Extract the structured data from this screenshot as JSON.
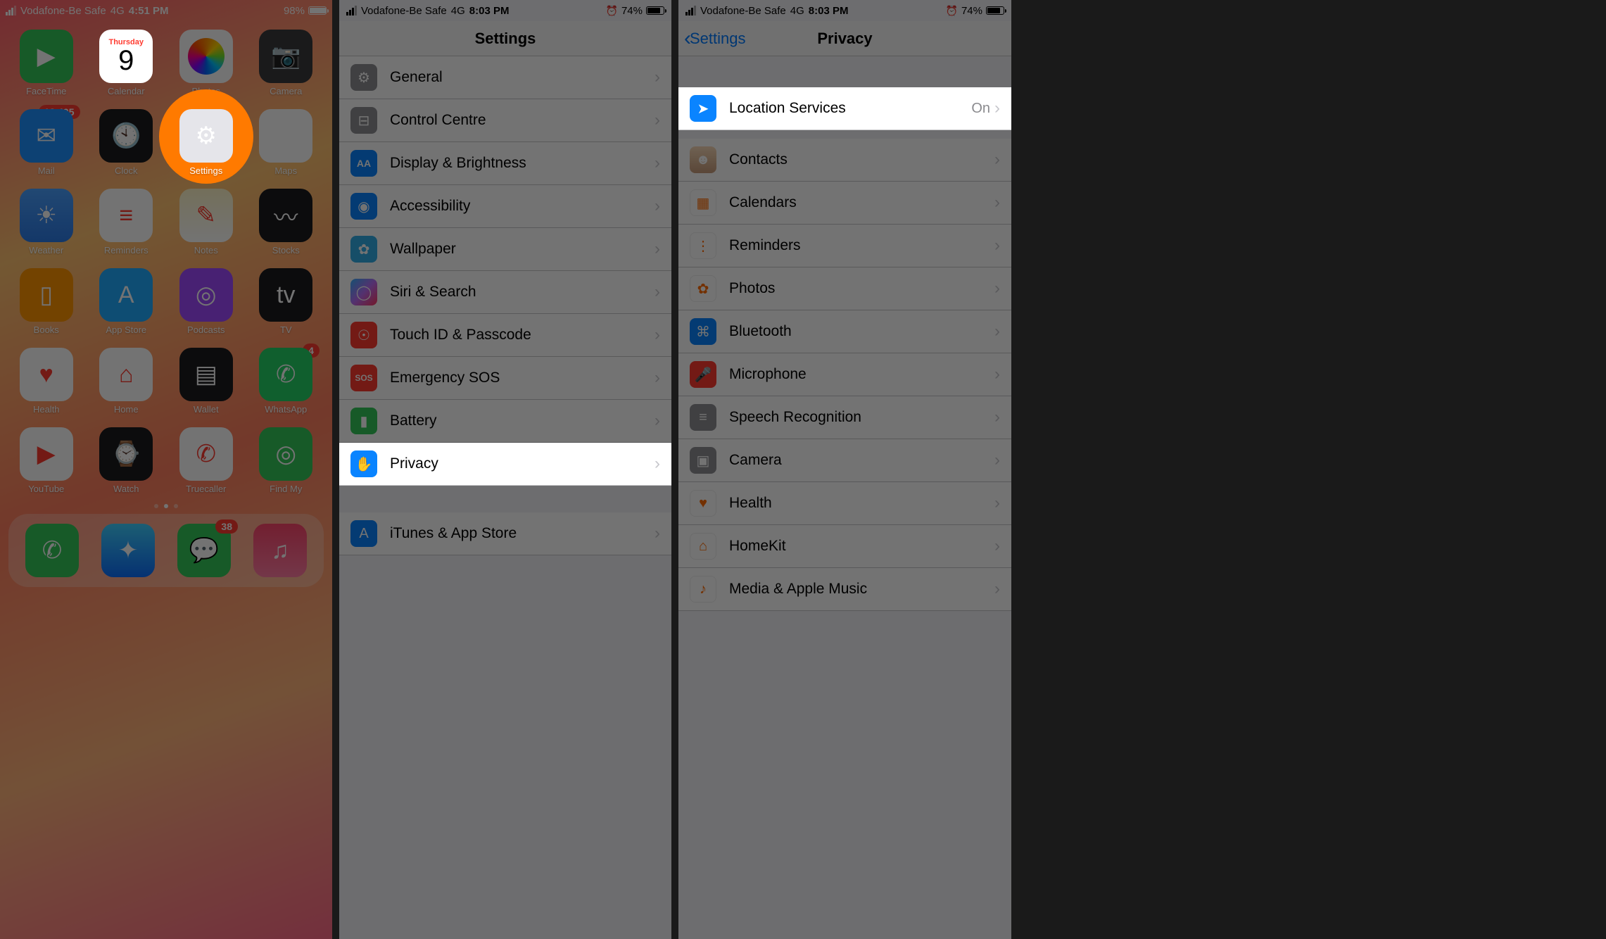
{
  "screen1": {
    "status": {
      "carrier": "Vodafone-Be Safe",
      "network": "4G",
      "time": "4:51 PM",
      "battery_pct": "98%"
    },
    "calendar": {
      "dow": "Thursday",
      "day": "9"
    },
    "apps": [
      {
        "name": "FaceTime",
        "icon": "facetime-icon"
      },
      {
        "name": "Calendar",
        "icon": "calendar-icon"
      },
      {
        "name": "Photos",
        "icon": "photos-icon"
      },
      {
        "name": "Camera",
        "icon": "camera-icon"
      },
      {
        "name": "Mail",
        "icon": "mail-icon",
        "badge": "18,495"
      },
      {
        "name": "Clock",
        "icon": "clock-icon"
      },
      {
        "name": "Settings",
        "icon": "settings-icon",
        "highlight": true
      },
      {
        "name": "Maps",
        "icon": "maps-icon"
      },
      {
        "name": "Weather",
        "icon": "weather-icon"
      },
      {
        "name": "Reminders",
        "icon": "reminders-icon"
      },
      {
        "name": "Notes",
        "icon": "notes-icon"
      },
      {
        "name": "Stocks",
        "icon": "stocks-icon"
      },
      {
        "name": "Books",
        "icon": "books-icon"
      },
      {
        "name": "App Store",
        "icon": "appstore-icon"
      },
      {
        "name": "Podcasts",
        "icon": "podcasts-icon"
      },
      {
        "name": "TV",
        "icon": "tv-icon"
      },
      {
        "name": "Health",
        "icon": "health-icon"
      },
      {
        "name": "Home",
        "icon": "home-icon"
      },
      {
        "name": "Wallet",
        "icon": "wallet-icon"
      },
      {
        "name": "WhatsApp",
        "icon": "whatsapp-icon",
        "badge": "4"
      },
      {
        "name": "YouTube",
        "icon": "youtube-icon"
      },
      {
        "name": "Watch",
        "icon": "watch-icon"
      },
      {
        "name": "Truecaller",
        "icon": "truecaller-icon"
      },
      {
        "name": "Find My",
        "icon": "findmy-icon"
      }
    ],
    "dock": [
      {
        "name": "Phone",
        "icon": "phone-icon"
      },
      {
        "name": "Safari",
        "icon": "safari-icon"
      },
      {
        "name": "Messages",
        "icon": "messages-icon",
        "badge": "38"
      },
      {
        "name": "Music",
        "icon": "music-icon"
      }
    ]
  },
  "screen2": {
    "status": {
      "carrier": "Vodafone-Be Safe",
      "network": "4G",
      "time": "8:03 PM",
      "battery_pct": "74%",
      "alarm": true
    },
    "title": "Settings",
    "rows": [
      {
        "label": "General",
        "icon": "gear-icon",
        "cls": "bg-gear",
        "glyph": "⚙"
      },
      {
        "label": "Control Centre",
        "icon": "controlcentre-icon",
        "cls": "bg-cc",
        "glyph": "⊟"
      },
      {
        "label": "Display & Brightness",
        "icon": "display-icon",
        "cls": "bg-disp",
        "glyph": "AA"
      },
      {
        "label": "Accessibility",
        "icon": "accessibility-icon",
        "cls": "bg-acc",
        "glyph": "◉"
      },
      {
        "label": "Wallpaper",
        "icon": "wallpaper-icon",
        "cls": "bg-wall",
        "glyph": "✿"
      },
      {
        "label": "Siri & Search",
        "icon": "siri-icon",
        "cls": "bg-siri",
        "glyph": "◯"
      },
      {
        "label": "Touch ID & Passcode",
        "icon": "touchid-icon",
        "cls": "bg-touch",
        "glyph": "☉"
      },
      {
        "label": "Emergency SOS",
        "icon": "sos-icon",
        "cls": "bg-sos",
        "glyph": "SOS"
      },
      {
        "label": "Battery",
        "icon": "battery-icon",
        "cls": "bg-batt",
        "glyph": "▮"
      },
      {
        "label": "Privacy",
        "icon": "privacy-icon",
        "cls": "bg-priv",
        "glyph": "✋",
        "highlight": true
      },
      {
        "gap": true
      },
      {
        "label": "iTunes & App Store",
        "icon": "itunes-icon",
        "cls": "bg-itunes",
        "glyph": "A"
      }
    ]
  },
  "screen3": {
    "status": {
      "carrier": "Vodafone-Be Safe",
      "network": "4G",
      "time": "8:03 PM",
      "battery_pct": "74%",
      "alarm": true
    },
    "back": "Settings",
    "title": "Privacy",
    "rows": [
      {
        "label": "Location Services",
        "icon": "location-icon",
        "cls": "bg-loc",
        "glyph": "➤",
        "value": "On",
        "highlight": true
      },
      {
        "gap": true,
        "short": true
      },
      {
        "label": "Contacts",
        "icon": "contacts-icon",
        "cls": "bg-cont",
        "glyph": "☻"
      },
      {
        "label": "Calendars",
        "icon": "calendars-icon",
        "cls": "bg-cal",
        "glyph": "▦"
      },
      {
        "label": "Reminders",
        "icon": "reminders-icon",
        "cls": "bg-rem",
        "glyph": "⋮"
      },
      {
        "label": "Photos",
        "icon": "photos-icon",
        "cls": "bg-photos",
        "glyph": "✿"
      },
      {
        "label": "Bluetooth",
        "icon": "bluetooth-icon",
        "cls": "bg-bt",
        "glyph": "⌘"
      },
      {
        "label": "Microphone",
        "icon": "microphone-icon",
        "cls": "bg-mic",
        "glyph": "🎤"
      },
      {
        "label": "Speech Recognition",
        "icon": "speech-icon",
        "cls": "bg-speech",
        "glyph": "≡"
      },
      {
        "label": "Camera",
        "icon": "camera-icon",
        "cls": "bg-cam",
        "glyph": "▣"
      },
      {
        "label": "Health",
        "icon": "health-icon",
        "cls": "bg-health",
        "glyph": "♥"
      },
      {
        "label": "HomeKit",
        "icon": "homekit-icon",
        "cls": "bg-home",
        "glyph": "⌂"
      },
      {
        "label": "Media & Apple Music",
        "icon": "media-icon",
        "cls": "bg-media",
        "glyph": "♪"
      }
    ]
  }
}
